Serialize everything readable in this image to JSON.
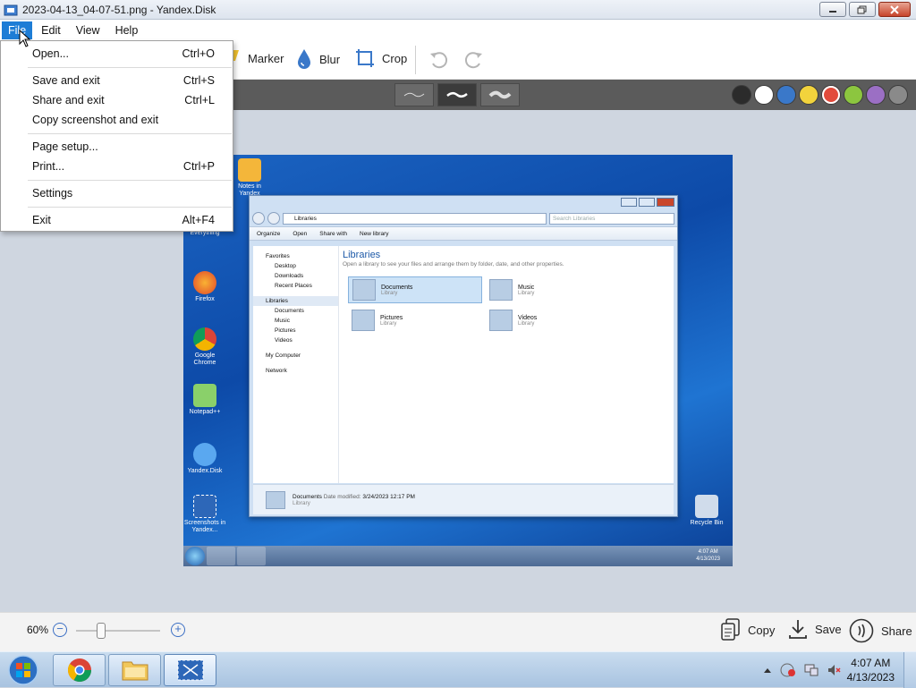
{
  "window": {
    "title": "2023-04-13_04-07-51.png - Yandex.Disk"
  },
  "menubar": {
    "items": [
      "File",
      "Edit",
      "View",
      "Help"
    ]
  },
  "file_menu": {
    "items": [
      {
        "label": "Open...",
        "shortcut": "Ctrl+O"
      },
      {
        "label": "Save and exit",
        "shortcut": "Ctrl+S"
      },
      {
        "label": "Share and exit",
        "shortcut": "Ctrl+L"
      },
      {
        "label": "Copy screenshot and exit",
        "shortcut": ""
      },
      {
        "label": "Page setup...",
        "shortcut": ""
      },
      {
        "label": "Print...",
        "shortcut": "Ctrl+P"
      },
      {
        "label": "Settings",
        "shortcut": ""
      },
      {
        "label": "Exit",
        "shortcut": "Alt+F4"
      }
    ]
  },
  "toolbar": {
    "marker": "Marker",
    "blur": "Blur",
    "crop": "Crop"
  },
  "stroke_widths": [
    "thin",
    "medium",
    "thick"
  ],
  "colors": [
    "#2b2b2b",
    "#ffffff",
    "#3a78c9",
    "#f2d33c",
    "#e24a3b",
    "#8cc63f",
    "#9b6fc4",
    "#8a8a8a"
  ],
  "selected_color": "#e24a3b",
  "screenshot": {
    "desktop_icons": [
      "Notes in Yandex",
      "Everything",
      "Firefox",
      "Google Chrome",
      "Notepad++",
      "Yandex.Disk",
      "Screenshots in Yandex...",
      "Recycle Bin"
    ],
    "explorer": {
      "address": "Libraries",
      "search_placeholder": "Search Libraries",
      "commands": [
        "Organize",
        "Open",
        "Share with",
        "New library"
      ],
      "nav": [
        "Favorites",
        "Desktop",
        "Downloads",
        "Recent Places",
        "Libraries",
        "Documents",
        "Music",
        "Pictures",
        "Videos",
        "My Computer",
        "Network"
      ],
      "heading": "Libraries",
      "subheading": "Open a library to see your files and arrange them by folder, date, and other properties.",
      "libraries": [
        {
          "name": "Documents",
          "type": "Library"
        },
        {
          "name": "Music",
          "type": "Library"
        },
        {
          "name": "Pictures",
          "type": "Library"
        },
        {
          "name": "Videos",
          "type": "Library"
        }
      ],
      "status": {
        "name": "Documents",
        "modified_label": "Date modified:",
        "modified": "3/24/2023 12:17 PM",
        "type": "Library"
      }
    },
    "clock": {
      "time": "4:07 AM",
      "date": "4/13/2023"
    }
  },
  "bottombar": {
    "zoom": "60%",
    "zoom_level_percent": 60,
    "copy": "Copy",
    "save": "Save",
    "share": "Share"
  },
  "taskbar": {
    "time": "4:07 AM",
    "date": "4/13/2023"
  }
}
